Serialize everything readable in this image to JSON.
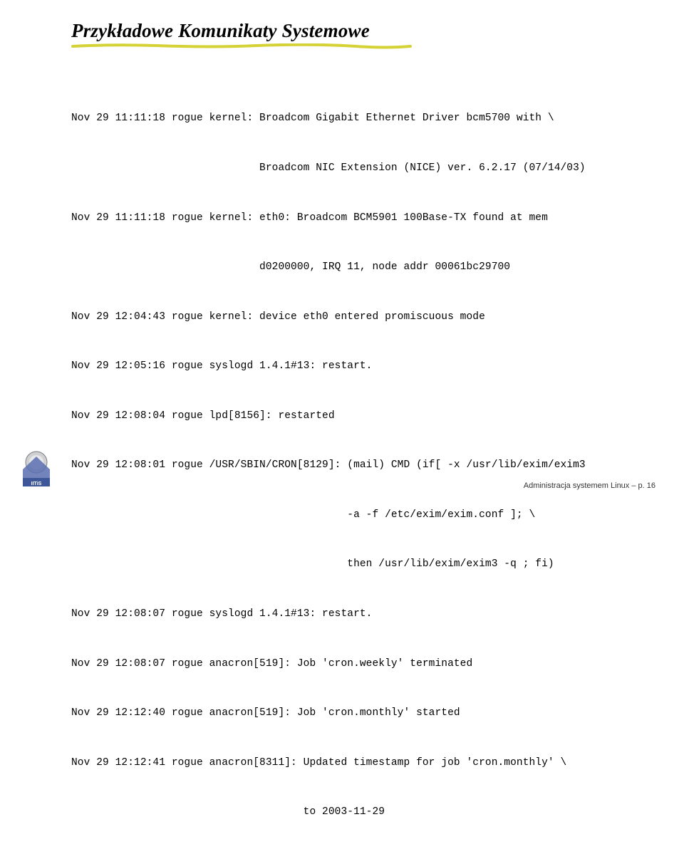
{
  "title": "Przykładowe Komunikaty Systemowe",
  "lines": [
    "Nov 29 11:11:18 rogue kernel: Broadcom Gigabit Ethernet Driver bcm5700 with \\",
    "                              Broadcom NIC Extension (NICE) ver. 6.2.17 (07/14/03)",
    "Nov 29 11:11:18 rogue kernel: eth0: Broadcom BCM5901 100Base-TX found at mem",
    "                              d0200000, IRQ 11, node addr 00061bc29700",
    "Nov 29 12:04:43 rogue kernel: device eth0 entered promiscuous mode",
    "Nov 29 12:05:16 rogue syslogd 1.4.1#13: restart.",
    "Nov 29 12:08:04 rogue lpd[8156]: restarted",
    "Nov 29 12:08:01 rogue /USR/SBIN/CRON[8129]: (mail) CMD (if[ -x /usr/lib/exim/exim3",
    "                                            -a -f /etc/exim/exim.conf ]; \\",
    "                                            then /usr/lib/exim/exim3 -q ; fi)",
    "Nov 29 12:08:07 rogue syslogd 1.4.1#13: restart.",
    "Nov 29 12:08:07 rogue anacron[519]: Job 'cron.weekly' terminated",
    "Nov 29 12:12:40 rogue anacron[519]: Job 'cron.monthly' started",
    "Nov 29 12:12:41 rogue anacron[8311]: Updated timestamp for job 'cron.monthly' \\",
    "                                     to 2003-11-29"
  ],
  "footer": "Administracja systemem Linux – p. 16"
}
